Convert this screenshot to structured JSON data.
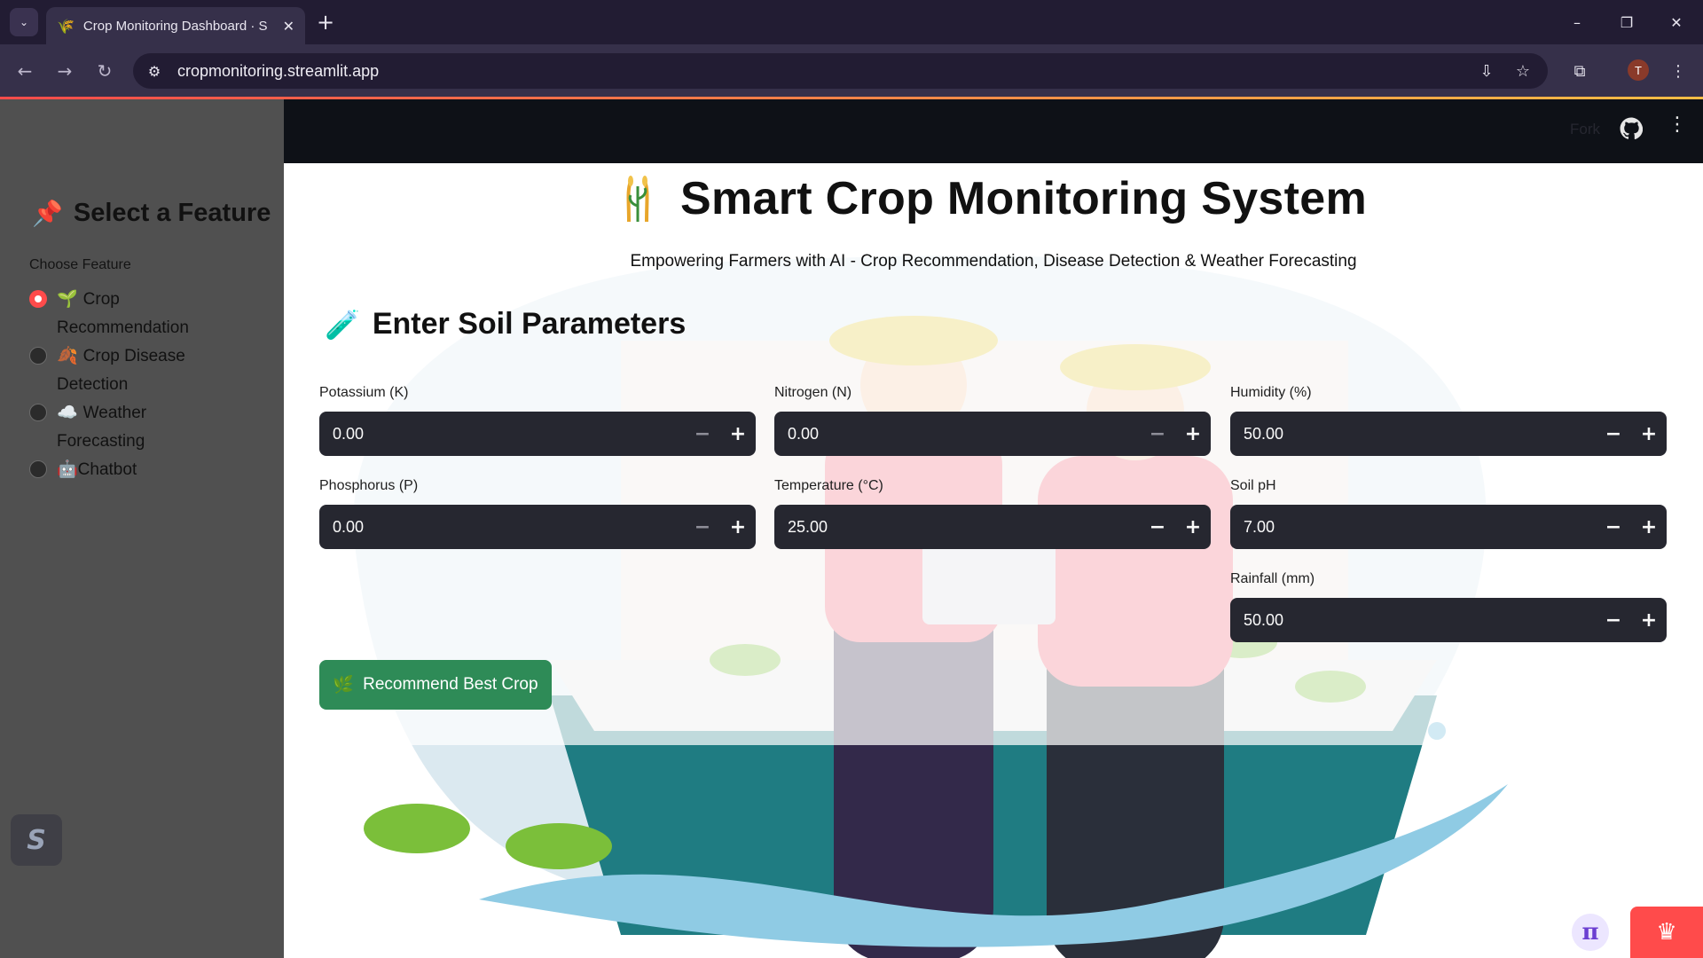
{
  "browser": {
    "tab_title": "Crop Monitoring Dashboard · S",
    "tab_favicon": "🌾",
    "tab_close": "✕",
    "new_tab": "+",
    "url": "cropmonitoring.streamlit.app",
    "profile_initial": "T",
    "icons": {
      "tab_list": "⌄",
      "back": "←",
      "forward": "→",
      "reload": "↻",
      "site_info": "⚙",
      "install": "⇩",
      "bookmark": "☆",
      "extensions": "⧉",
      "menu": "⋮",
      "minimize": "–",
      "restore": "❐",
      "close": "✕"
    }
  },
  "sidebar": {
    "title_icon": "📌",
    "title": "Select a Feature",
    "label": "Choose Feature",
    "options": [
      {
        "emoji": "🌱",
        "label": "Crop Recommendation",
        "selected": true
      },
      {
        "emoji": "🍂",
        "label": "Crop Disease Detection",
        "selected": false
      },
      {
        "emoji": "☁️",
        "label": "Weather Forecasting",
        "selected": false
      },
      {
        "emoji": "🤖",
        "label": "Chatbot",
        "selected": false
      }
    ]
  },
  "header": {
    "fork_label": "Fork",
    "github_icon": "github-icon",
    "menu_icon": "⋮"
  },
  "main": {
    "title": "Smart Crop Monitoring System",
    "subtitle": "Empowering Farmers with AI - Crop Recommendation, Disease Detection & Weather Forecasting",
    "section_icon": "🧪",
    "section_title": "Enter Soil Parameters",
    "fields": [
      {
        "label": "Potassium (K)",
        "value": "0.00"
      },
      {
        "label": "Nitrogen (N)",
        "value": "0.00"
      },
      {
        "label": "Humidity (%)",
        "value": "50.00"
      },
      {
        "label": "Phosphorus (P)",
        "value": "0.00"
      },
      {
        "label": "Temperature (°C)",
        "value": "25.00"
      },
      {
        "label": "Soil pH",
        "value": "7.00"
      },
      {
        "label": "Rainfall (mm)",
        "value": "50.00"
      }
    ],
    "stepper": {
      "minus": "−",
      "plus": "+"
    },
    "button_emoji": "🌿",
    "button_label": "Recommend Best Crop"
  },
  "colors": {
    "accent": "#ff4b4b",
    "button": "#2e8b57",
    "input_bg": "#262730",
    "sidebar_bg": "#505050",
    "header_bg": "#0e1117"
  }
}
